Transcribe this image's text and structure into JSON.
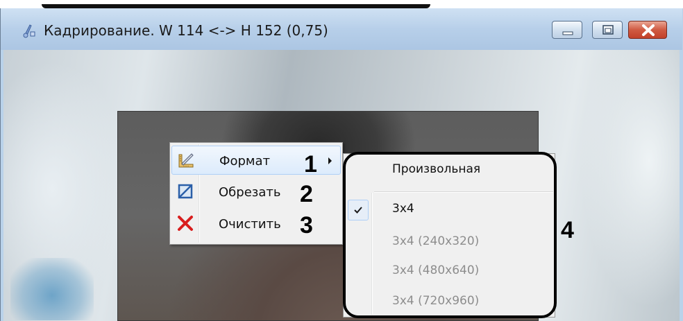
{
  "window": {
    "title": "Кадрирование. W 114 <-> H 152 (0,75)",
    "icons": {
      "app": "crop-tool-icon",
      "minimize": "minimize-icon",
      "maximize": "maximize-icon",
      "close": "close-icon"
    },
    "colors": {
      "titlebar": "#b7cfe9",
      "close_button": "#c2412a"
    }
  },
  "context_menu": {
    "items": [
      {
        "label": "Формат",
        "icon": "format-ruler-icon",
        "has_submenu": true,
        "highlighted": true,
        "callout": "1"
      },
      {
        "label": "Обрезать",
        "icon": "crop-icon",
        "has_submenu": false,
        "highlighted": false,
        "callout": "2"
      },
      {
        "label": "Очистить",
        "icon": "clear-x-icon",
        "has_submenu": false,
        "highlighted": false,
        "callout": "3"
      }
    ]
  },
  "submenu": {
    "callout": "4",
    "items": [
      {
        "label": "Произвольная",
        "enabled": true,
        "checked": false
      },
      {
        "label": "3x4",
        "enabled": true,
        "checked": true
      },
      {
        "label": "3x4 (240x320)",
        "enabled": false,
        "checked": false
      },
      {
        "label": "3x4 (480x640)",
        "enabled": false,
        "checked": false
      },
      {
        "label": "3x4 (720x960)",
        "enabled": false,
        "checked": false
      }
    ]
  }
}
